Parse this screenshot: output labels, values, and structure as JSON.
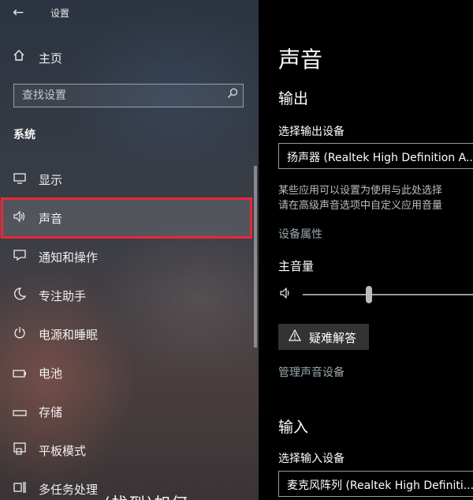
{
  "window": {
    "title": "设置"
  },
  "sidebar": {
    "home_label": "主页",
    "search_placeholder": "查找设置",
    "section_title": "系统",
    "items": [
      {
        "label": "显示",
        "icon": "monitor-icon"
      },
      {
        "label": "声音",
        "icon": "speaker-icon",
        "selected": true
      },
      {
        "label": "通知和操作",
        "icon": "notification-icon"
      },
      {
        "label": "专注助手",
        "icon": "moon-icon"
      },
      {
        "label": "电源和睡眠",
        "icon": "power-icon"
      },
      {
        "label": "电池",
        "icon": "battery-icon"
      },
      {
        "label": "存储",
        "icon": "storage-icon"
      },
      {
        "label": "平板模式",
        "icon": "tablet-icon"
      },
      {
        "label": "多任务处理",
        "icon": "multitask-icon"
      }
    ],
    "overlay_caption": "(找到)如何"
  },
  "main": {
    "page_title": "声音",
    "output": {
      "heading": "输出",
      "device_label": "选择输出设备",
      "device_value": "扬声器 (Realtek High Definition A...",
      "description_line1": "某些应用可以设置为使用与此处选择",
      "description_line2": "请在高级声音选项中自定义应用音量",
      "device_properties_link": "设备属性",
      "master_volume_label": "主音量",
      "master_volume": 0.38,
      "troubleshoot_label": "疑难解答",
      "manage_devices_link": "管理声音设备"
    },
    "input": {
      "heading": "输入",
      "device_label": "选择输入设备",
      "device_value": "麦克风阵列 (Realtek High Definiti..."
    }
  },
  "colors": {
    "highlight": "#e8283a",
    "link": "#9aa7ad"
  }
}
